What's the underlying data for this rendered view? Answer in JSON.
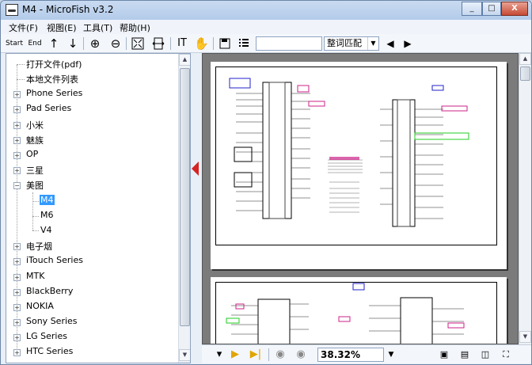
{
  "window": {
    "title": "M4 - MicroFish v3.2",
    "min_label": "_",
    "max_label": "□",
    "close_label": "X"
  },
  "menu": {
    "file": "文件(F)",
    "view": "视图(E)",
    "tools": "工具(T)",
    "help": "帮助(H)"
  },
  "toolbar": {
    "start_label": "Start",
    "end_label": "End",
    "search_placeholder": "",
    "match_mode": "整词匹配"
  },
  "tree": {
    "open_file": "打开文件(pdf)",
    "local_list": "本地文件列表",
    "items": [
      "Phone Series",
      "Pad Series",
      "小米",
      "魅族",
      "OP",
      "三星",
      "美图",
      "电子烟",
      "iTouch Series",
      "MTK",
      "BlackBerry",
      "NOKIA",
      "Sony Series",
      "LG Series",
      "HTC Series"
    ],
    "meitu_children": [
      "M4",
      "M6",
      "V4"
    ],
    "selected": "M4"
  },
  "viewer": {
    "zoom": "38.32%"
  },
  "colors": {
    "selection": "#3399ff",
    "splitter_arrow": "#d62323",
    "viewer_bg": "#7b7b7b"
  }
}
